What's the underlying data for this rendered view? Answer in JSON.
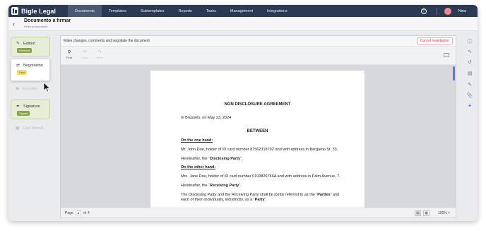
{
  "brand": {
    "name": "Bigle Legal"
  },
  "nav": {
    "items": [
      "Documents",
      "Templates",
      "Subtemplates",
      "Reports",
      "Tasks",
      "Management",
      "Integrations"
    ],
    "active": "Documents"
  },
  "user": {
    "name": "Nina"
  },
  "header": {
    "title": "Documento a firmar",
    "subtitle": "External document"
  },
  "stages": [
    {
      "label": "Edition",
      "badge": "Finished"
    },
    {
      "label": "Negotiation",
      "badge": "Sent"
    },
    {
      "label": "Revision"
    },
    {
      "label": "Signature",
      "badge": "Signed"
    },
    {
      "label": "Cold Stored"
    }
  ],
  "banner": {
    "text": "Make changes, comments and negotiate the document",
    "cancel_label": "Cancel negotiation"
  },
  "toolbar": {
    "find": "Find",
    "undo": "Undo",
    "redo": "Redo"
  },
  "document": {
    "title": "NON DISCLOSURE AGREEMENT",
    "place_date": "In Brussels, on May 23, 2024",
    "between": "BETWEEN",
    "one_hand": "On the one hand:",
    "party1": "Mr. John Doe, holder of ID card number 8756231879Z and with address in Bergamo St. 33.",
    "party1_ref_pre": "Hereinafter, the “",
    "party1_ref": "Disclosing Party",
    "party1_ref_post": "”.",
    "other_hand": "On the other hand:",
    "party2": "Mrs. Jane Doe, holder of ID card number 0193826746A and with address in Palm Avenue, 7.",
    "party2_ref_pre": "Hereinafter, the “",
    "party2_ref": "Receiving Party",
    "party2_ref_post": "”.",
    "joint_pre": "The Disclosing Party and the Receiving Party shall be jointly referred to as the “",
    "joint_parties": "Parties",
    "joint_post": "” and",
    "joint2_pre": "each of them individually, indistinctly, as a “",
    "joint2_party": "Party",
    "joint2_post": "”."
  },
  "footer": {
    "page_label": "Page",
    "page": "1",
    "of_label": "of",
    "total": "4",
    "zoom": "100%"
  }
}
